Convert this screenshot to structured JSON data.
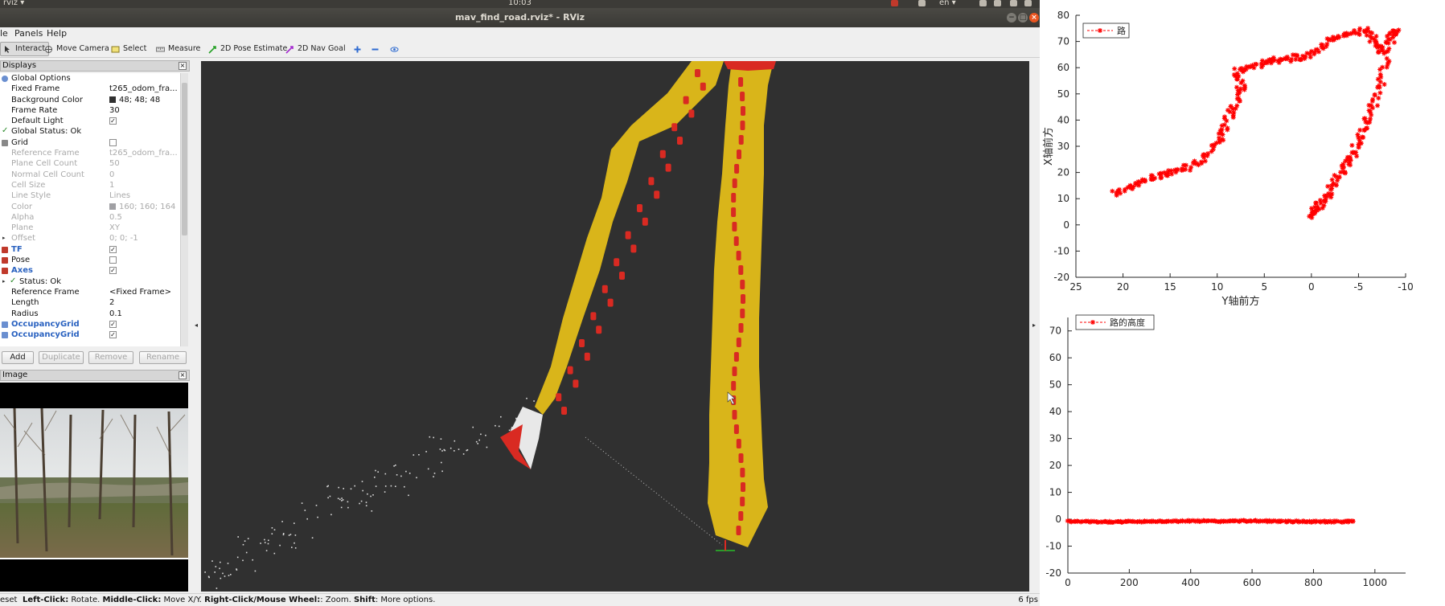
{
  "topbar": {
    "app": "rviz ▾",
    "clock": "10:03",
    "lang": "en ▾"
  },
  "window": {
    "title": "mav_find_road.rviz* - RViz"
  },
  "menu": [
    "le",
    "Panels",
    "Help"
  ],
  "toolbar": {
    "interact": "Interact",
    "move_camera": "Move Camera",
    "select": "Select",
    "measure": "Measure",
    "pose_estimate": "2D Pose Estimate",
    "nav_goal": "2D Nav Goal"
  },
  "displays": {
    "title": "Displays",
    "rows": [
      {
        "label": "Global Options",
        "value": "",
        "state": "normal",
        "icon": "globe-icon",
        "checkbox": false
      },
      {
        "label": "Fixed Frame",
        "value": "t265_odom_fra...",
        "state": "normal"
      },
      {
        "label": "Background Color",
        "value": "48; 48; 48",
        "state": "normal",
        "swatch": "#303030"
      },
      {
        "label": "Frame Rate",
        "value": "30",
        "state": "normal"
      },
      {
        "label": "Default Light",
        "value": "",
        "state": "normal",
        "checkbox": true,
        "checked": true
      },
      {
        "label": "Global Status: Ok",
        "value": "",
        "state": "normal",
        "icon": "check-icon"
      },
      {
        "label": "Grid",
        "value": "",
        "state": "normal",
        "icon": "grid-icon",
        "checkbox": true,
        "checked": false
      },
      {
        "label": "Reference Frame",
        "value": "t265_odom_fra...",
        "state": "dim"
      },
      {
        "label": "Plane Cell Count",
        "value": "50",
        "state": "dim"
      },
      {
        "label": "Normal Cell Count",
        "value": "0",
        "state": "dim"
      },
      {
        "label": "Cell Size",
        "value": "1",
        "state": "dim"
      },
      {
        "label": "Line Style",
        "value": "Lines",
        "state": "dim"
      },
      {
        "label": "Color",
        "value": "160; 160; 164",
        "state": "dim",
        "swatch": "#a0a0a4"
      },
      {
        "label": "Alpha",
        "value": "0.5",
        "state": "dim"
      },
      {
        "label": "Plane",
        "value": "XY",
        "state": "dim"
      },
      {
        "label": "Offset",
        "value": "0; 0; -1",
        "state": "dim",
        "expander": true
      },
      {
        "label": "TF",
        "value": "",
        "state": "blue",
        "icon": "tf-icon",
        "checkbox": true,
        "checked": true
      },
      {
        "label": "Pose",
        "value": "",
        "state": "normal",
        "icon": "pose-icon",
        "checkbox": true,
        "checked": false
      },
      {
        "label": "Axes",
        "value": "",
        "state": "blue",
        "icon": "axes-icon",
        "checkbox": true,
        "checked": true
      },
      {
        "label": "Status: Ok",
        "value": "",
        "state": "normal",
        "icon": "check-icon",
        "expander": true
      },
      {
        "label": "Reference Frame",
        "value": "<Fixed Frame>",
        "state": "normal"
      },
      {
        "label": "Length",
        "value": "2",
        "state": "normal"
      },
      {
        "label": "Radius",
        "value": "0.1",
        "state": "normal"
      },
      {
        "label": "OccupancyGrid",
        "value": "",
        "state": "blue",
        "icon": "grid-map-icon",
        "checkbox": true,
        "checked": true
      },
      {
        "label": "OccupancyGrid",
        "value": "",
        "state": "blue",
        "icon": "grid-map-icon",
        "checkbox": true,
        "checked": true
      }
    ],
    "buttons": {
      "add": "Add",
      "duplicate": "Duplicate",
      "remove": "Remove",
      "rename": "Rename"
    }
  },
  "image_panel": {
    "title": "Image"
  },
  "statusbar": {
    "reset": "eset",
    "k1": "Left-Click:",
    "t1": " Rotate. ",
    "k2": "Middle-Click:",
    "t2": " Move X/Y. ",
    "k3": "Right-Click/Mouse Wheel:",
    "t3": ": Zoom. ",
    "k4": "Shift",
    "t4": ": More options.",
    "fps": "6 fps"
  },
  "colors": {
    "road_yellow": "#d9b51a",
    "road_red": "#d92a22",
    "plot_red": "#ff0000",
    "view_bg": "#303030"
  },
  "chart_data": [
    {
      "type": "scatter",
      "title": "",
      "xlabel": "Y轴前方",
      "ylabel": "X轴前方",
      "xlim": [
        25,
        -10
      ],
      "ylim": [
        -20,
        80
      ],
      "xticks": [
        "25",
        "20",
        "15",
        "10",
        "5",
        "0",
        "-5",
        "-10"
      ],
      "yticks": [
        "80",
        "70",
        "60",
        "50",
        "40",
        "30",
        "20",
        "10",
        "0",
        "-10",
        "-20"
      ],
      "legend": "路",
      "legend_position": "top-left",
      "series": [
        {
          "name": "路",
          "marker": "*",
          "color": "#ff0000",
          "points": [
            [
              21,
              12
            ],
            [
              20,
              13
            ],
            [
              19,
              15
            ],
            [
              18,
              16
            ],
            [
              17,
              18
            ],
            [
              16,
              19
            ],
            [
              15,
              20
            ],
            [
              14,
              21
            ],
            [
              13,
              22
            ],
            [
              12,
              24
            ],
            [
              11,
              27
            ],
            [
              10,
              31
            ],
            [
              9.5,
              35
            ],
            [
              9,
              39
            ],
            [
              8.5,
              43
            ],
            [
              8,
              47
            ],
            [
              7.5,
              51
            ],
            [
              7.5,
              55
            ],
            [
              8,
              58
            ],
            [
              7,
              60
            ],
            [
              6,
              61
            ],
            [
              5,
              62
            ],
            [
              4,
              63
            ],
            [
              3,
              63
            ],
            [
              2,
              64
            ],
            [
              1,
              64
            ],
            [
              0,
              65
            ],
            [
              -1,
              67
            ],
            [
              -2,
              70
            ],
            [
              -3,
              72
            ],
            [
              -4,
              73
            ],
            [
              -5,
              74
            ],
            [
              -6,
              74
            ],
            [
              -6.5,
              72
            ],
            [
              -7,
              68
            ],
            [
              -7.5,
              66
            ],
            [
              -8.5,
              73
            ],
            [
              -9,
              74
            ],
            [
              -8.5,
              70
            ],
            [
              -8,
              62
            ],
            [
              -7.5,
              56
            ],
            [
              -7,
              50
            ],
            [
              -6.5,
              45
            ],
            [
              -6,
              40
            ],
            [
              -5.5,
              36
            ],
            [
              -5,
              32
            ],
            [
              -4.5,
              28
            ],
            [
              -4,
              25
            ],
            [
              -3.5,
              22
            ],
            [
              -3,
              19
            ],
            [
              -2.5,
              16
            ],
            [
              -2,
              13
            ],
            [
              -1.5,
              10
            ],
            [
              -1,
              8
            ],
            [
              -0.5,
              6
            ],
            [
              -0.2,
              4
            ],
            [
              0,
              3
            ]
          ]
        }
      ]
    },
    {
      "type": "line",
      "title": "",
      "xlabel": "",
      "ylabel": "",
      "xlim": [
        0,
        1100
      ],
      "ylim": [
        -20,
        75
      ],
      "xticks": [
        "0",
        "200",
        "400",
        "600",
        "800",
        "1000"
      ],
      "yticks": [
        "70",
        "60",
        "50",
        "40",
        "30",
        "20",
        "10",
        "0",
        "-10",
        "-20"
      ],
      "legend": "路的高度",
      "legend_position": "top-left",
      "series": [
        {
          "name": "路的高度",
          "marker": "*",
          "color": "#ff0000",
          "points": [
            [
              0,
              -0.8
            ],
            [
              50,
              -0.9
            ],
            [
              100,
              -1.0
            ],
            [
              150,
              -1.0
            ],
            [
              200,
              -0.9
            ],
            [
              250,
              -0.8
            ],
            [
              300,
              -0.8
            ],
            [
              350,
              -0.7
            ],
            [
              400,
              -0.6
            ],
            [
              450,
              -0.7
            ],
            [
              500,
              -0.8
            ],
            [
              550,
              -0.7
            ],
            [
              600,
              -0.6
            ],
            [
              650,
              -0.7
            ],
            [
              700,
              -0.8
            ],
            [
              750,
              -0.8
            ],
            [
              800,
              -0.9
            ],
            [
              850,
              -0.9
            ],
            [
              900,
              -0.9
            ],
            [
              930,
              -0.8
            ]
          ]
        }
      ]
    }
  ]
}
